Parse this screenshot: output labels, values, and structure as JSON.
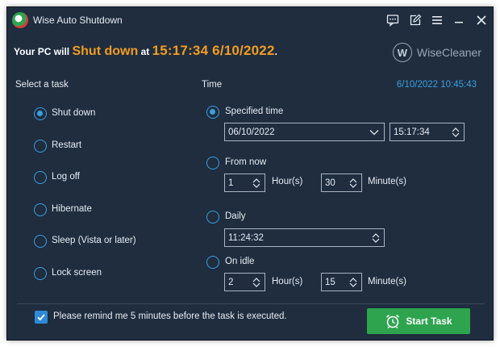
{
  "window": {
    "title": "Wise Auto Shutdown"
  },
  "status": {
    "prefix": "Your PC will",
    "action": "Shut down",
    "at": "at",
    "datetime": "15:17:34 6/10/2022",
    "suffix": "."
  },
  "brand": {
    "name": "WiseCleaner",
    "logo_letter": "W"
  },
  "tasks": {
    "heading": "Select a task",
    "items": [
      {
        "label": "Shut down",
        "checked": true
      },
      {
        "label": "Restart",
        "checked": false
      },
      {
        "label": "Log off",
        "checked": false
      },
      {
        "label": "Hibernate",
        "checked": false
      },
      {
        "label": "Sleep (Vista or later)",
        "checked": false
      },
      {
        "label": "Lock screen",
        "checked": false
      }
    ]
  },
  "time": {
    "heading": "Time",
    "clock": "6/10/2022 10:45:43",
    "specified": {
      "label": "Specified time",
      "checked": true,
      "date": "06/10/2022",
      "time": "15:17:34"
    },
    "from_now": {
      "label": "From now",
      "checked": false,
      "hours": "1",
      "hours_unit": "Hour(s)",
      "minutes": "30",
      "minutes_unit": "Minute(s)"
    },
    "daily": {
      "label": "Daily",
      "checked": false,
      "time": "11:24:32"
    },
    "on_idle": {
      "label": "On idle",
      "checked": false,
      "hours": "2",
      "hours_unit": "Hour(s)",
      "minutes": "15",
      "minutes_unit": "Minute(s)"
    }
  },
  "footer": {
    "remind_checked": true,
    "remind_label": "Please remind me 5 minutes before the task is executed.",
    "start_label": "Start Task"
  },
  "colors": {
    "background": "#1f2d3f",
    "accent": "#3a9fdf",
    "highlight": "#f39c1f",
    "start_button": "#2ea44f"
  }
}
